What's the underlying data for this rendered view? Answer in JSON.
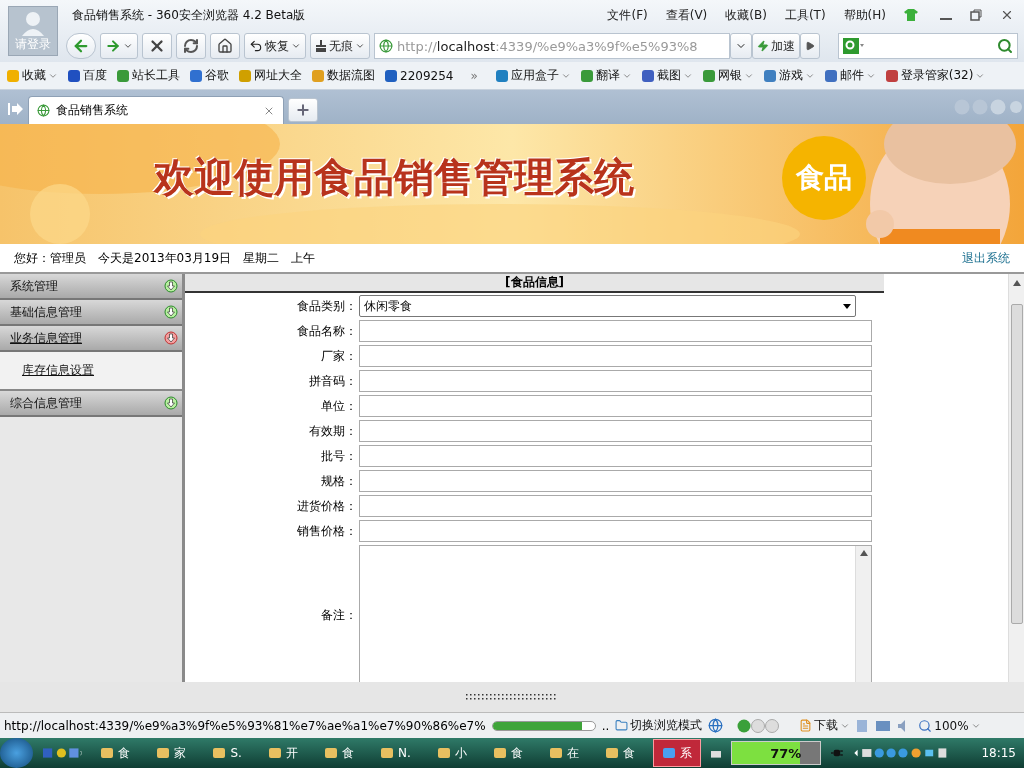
{
  "browser": {
    "avatar_label": "请登录",
    "title": "食品销售系统 - 360安全浏览器 4.2 Beta版",
    "menu": [
      "文件(F)",
      "查看(V)",
      "收藏(B)",
      "工具(T)",
      "帮助(H)"
    ]
  },
  "toolbar": {
    "restore": "恢复",
    "incognito": "无痕",
    "address_scheme": "http://",
    "address_host": "localhost",
    "address_rest": ":4339/%e9%a3%9f%e5%93%8",
    "speed": "加速"
  },
  "bookmarks": [
    {
      "label": "收藏",
      "has_menu": true
    },
    {
      "label": "百度",
      "has_menu": false
    },
    {
      "label": "站长工具",
      "has_menu": false
    },
    {
      "label": "谷歌",
      "has_menu": false
    },
    {
      "label": "网址大全",
      "has_menu": false
    },
    {
      "label": "数据流图",
      "has_menu": false
    },
    {
      "label": "2209254",
      "has_menu": false
    },
    {
      "label": "»",
      "kind": "more",
      "has_menu": false
    },
    {
      "label": "应用盒子",
      "has_menu": true
    },
    {
      "label": "翻译",
      "has_menu": true
    },
    {
      "label": "截图",
      "has_menu": true
    },
    {
      "label": "网银",
      "has_menu": true
    },
    {
      "label": "游戏",
      "has_menu": true
    },
    {
      "label": "邮件",
      "has_menu": true
    },
    {
      "label": "登录管家(32)",
      "has_menu": true
    }
  ],
  "tabs": [
    {
      "label": "食品销售系统",
      "selected": true
    }
  ],
  "banner": {
    "title": "欢迎使用食品销售管理系统",
    "badge": "食品"
  },
  "greeting": {
    "user": "您好：管理员",
    "date": "今天是2013年03月19日",
    "weekday": "星期二",
    "period": "上午",
    "logout": "退出系统"
  },
  "sidebar": {
    "items": [
      {
        "label": "系统管理",
        "expanded": false
      },
      {
        "label": "基础信息管理",
        "expanded": false
      },
      {
        "label": "业务信息管理",
        "expanded": true,
        "children": [
          {
            "label": "库存信息设置"
          }
        ]
      },
      {
        "label": "综合信息管理",
        "expanded": false
      }
    ]
  },
  "form": {
    "title": "[食品信息]",
    "fields": [
      {
        "label": "食品类别：",
        "kind": "select",
        "value": "休闲零食"
      },
      {
        "label": "食品名称：",
        "kind": "text"
      },
      {
        "label": "厂家：",
        "kind": "text"
      },
      {
        "label": "拼音码：",
        "kind": "text"
      },
      {
        "label": "单位：",
        "kind": "text"
      },
      {
        "label": "有效期：",
        "kind": "text"
      },
      {
        "label": "批号：",
        "kind": "text"
      },
      {
        "label": "规格：",
        "kind": "text"
      },
      {
        "label": "进货价格：",
        "kind": "text"
      },
      {
        "label": "销售价格：",
        "kind": "text"
      },
      {
        "label": "备注：",
        "kind": "textarea"
      }
    ]
  },
  "status_bar": {
    "url": "http://localhost:4339/%e9%a3%9f%e5%93%81%e7%ae%a1%e7%90%86%e7%",
    "progress": {
      "level": 0.88
    },
    "ellipsis": "..",
    "mode": "切换浏览模式",
    "download": "下载",
    "zoom": "100%"
  },
  "taskbar": {
    "items": [
      {
        "label": "食",
        "selected": false
      },
      {
        "label": "家",
        "selected": false
      },
      {
        "label": "S.",
        "selected": false
      },
      {
        "label": "开",
        "selected": false
      },
      {
        "label": "食",
        "selected": false
      },
      {
        "label": "N.",
        "selected": false
      },
      {
        "label": "小",
        "selected": false
      },
      {
        "label": "食",
        "selected": false
      },
      {
        "label": "在",
        "selected": false
      },
      {
        "label": "食",
        "selected": false
      },
      {
        "label": "系",
        "selected": true
      }
    ],
    "battery": {
      "label": "77%",
      "level": 0.77
    },
    "clock": "18:15"
  }
}
